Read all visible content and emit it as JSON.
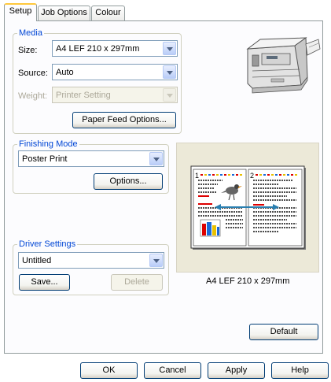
{
  "tabs": [
    {
      "label": "Setup"
    },
    {
      "label": "Job Options"
    },
    {
      "label": "Colour"
    }
  ],
  "media": {
    "title": "Media",
    "size_label": "Size:",
    "size_value": "A4 LEF 210 x 297mm",
    "source_label": "Source:",
    "source_value": "Auto",
    "weight_label": "Weight:",
    "weight_value": "Printer Setting",
    "paper_feed_button": "Paper Feed Options..."
  },
  "finishing": {
    "title": "Finishing Mode",
    "mode_value": "Poster Print",
    "options_button": "Options..."
  },
  "driver": {
    "title": "Driver Settings",
    "value": "Untitled",
    "save_button": "Save...",
    "delete_button": "Delete"
  },
  "preview": {
    "page_numbers": [
      "1",
      "2"
    ],
    "caption": "A4 LEF 210 x 297mm"
  },
  "default_button": "Default",
  "footer": {
    "ok": "OK",
    "cancel": "Cancel",
    "apply": "Apply",
    "help": "Help"
  }
}
